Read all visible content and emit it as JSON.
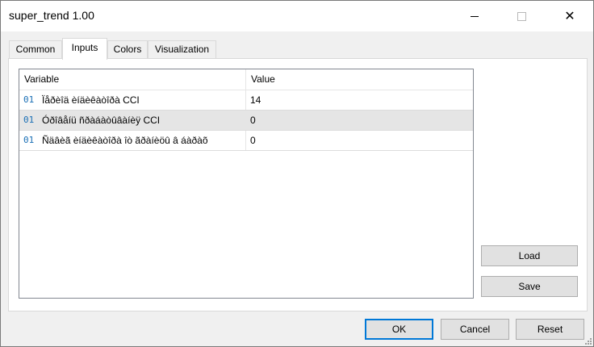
{
  "window": {
    "title": "super_trend 1.00",
    "close_glyph": "✕"
  },
  "tabs": [
    {
      "label": "Common",
      "active": false
    },
    {
      "label": "Inputs",
      "active": true
    },
    {
      "label": "Colors",
      "active": false
    },
    {
      "label": "Visualization",
      "active": false
    }
  ],
  "table": {
    "headers": {
      "variable": "Variable",
      "value": "Value"
    },
    "rows": [
      {
        "type_icon": "01",
        "name": "Ïåðèîä èíäèêàòîðà CCI",
        "value": "14",
        "selected": false
      },
      {
        "type_icon": "01",
        "name": "Óðîâåíü ñðàáàòûâàíèÿ CCI",
        "value": "0",
        "selected": true
      },
      {
        "type_icon": "01",
        "name": "Ñäâèã èíäèêàòîðà îò ãðàíèöû â áàðàõ",
        "value": "0",
        "selected": false
      }
    ]
  },
  "side_buttons": {
    "load": "Load",
    "save": "Save"
  },
  "footer_buttons": {
    "ok": "OK",
    "cancel": "Cancel",
    "reset": "Reset"
  },
  "colors": {
    "accent": "#0078d7",
    "icon": "#1a6fb5",
    "selected_row": "#e5e5e5"
  }
}
